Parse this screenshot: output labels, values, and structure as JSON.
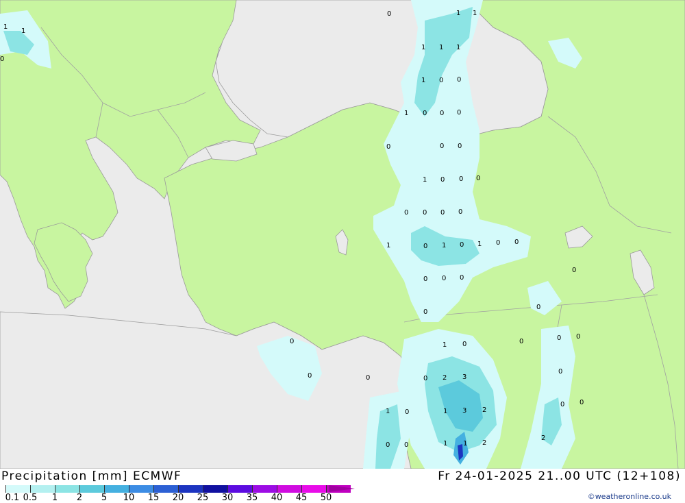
{
  "header": {
    "title": "Precipitation [mm] ECMWF",
    "datetime": "Fr 24-01-2025 21..00 UTC (12+108)"
  },
  "legend": {
    "labels": [
      "0.1",
      "0.5",
      "1",
      "2",
      "5",
      "10",
      "15",
      "20",
      "25",
      "30",
      "35",
      "40",
      "45",
      "50"
    ],
    "colors": [
      "#d4fafa",
      "#b4f0f0",
      "#8ce4e4",
      "#5ccadc",
      "#44b0e0",
      "#3c8ce4",
      "#2c60d4",
      "#1c34c0",
      "#1010a0",
      "#5c0ce0",
      "#9c0ce4",
      "#d00ce0",
      "#e80ce8",
      "#c000c0"
    ]
  },
  "credit": "©weatheronline.co.uk",
  "colors": {
    "land": "#c8f5a0",
    "sea": "#ebebeb",
    "border": "#a0a0a0",
    "precip_light": "#d4fafa",
    "precip_mid": "#8ce4e4",
    "precip_high": "#44b0e0",
    "precip_peak": "#1c34c0"
  },
  "map_values": [
    "0",
    "1",
    "1",
    "1",
    "1",
    "0",
    "1",
    "1",
    "1",
    "1",
    "0",
    "0",
    "1",
    "0",
    "0",
    "0",
    "0",
    "0",
    "0",
    "1",
    "0",
    "0",
    "0",
    "0",
    "0",
    "1",
    "0",
    "1",
    "0",
    "1",
    "0",
    "0",
    "0",
    "0",
    "0",
    "0",
    "0",
    "0",
    "1",
    "0",
    "0",
    "0",
    "0",
    "0",
    "0",
    "0",
    "2",
    "3",
    "1",
    "0",
    "1",
    "3",
    "2",
    "0",
    "0",
    "0",
    "1",
    "1",
    "2",
    "2"
  ]
}
